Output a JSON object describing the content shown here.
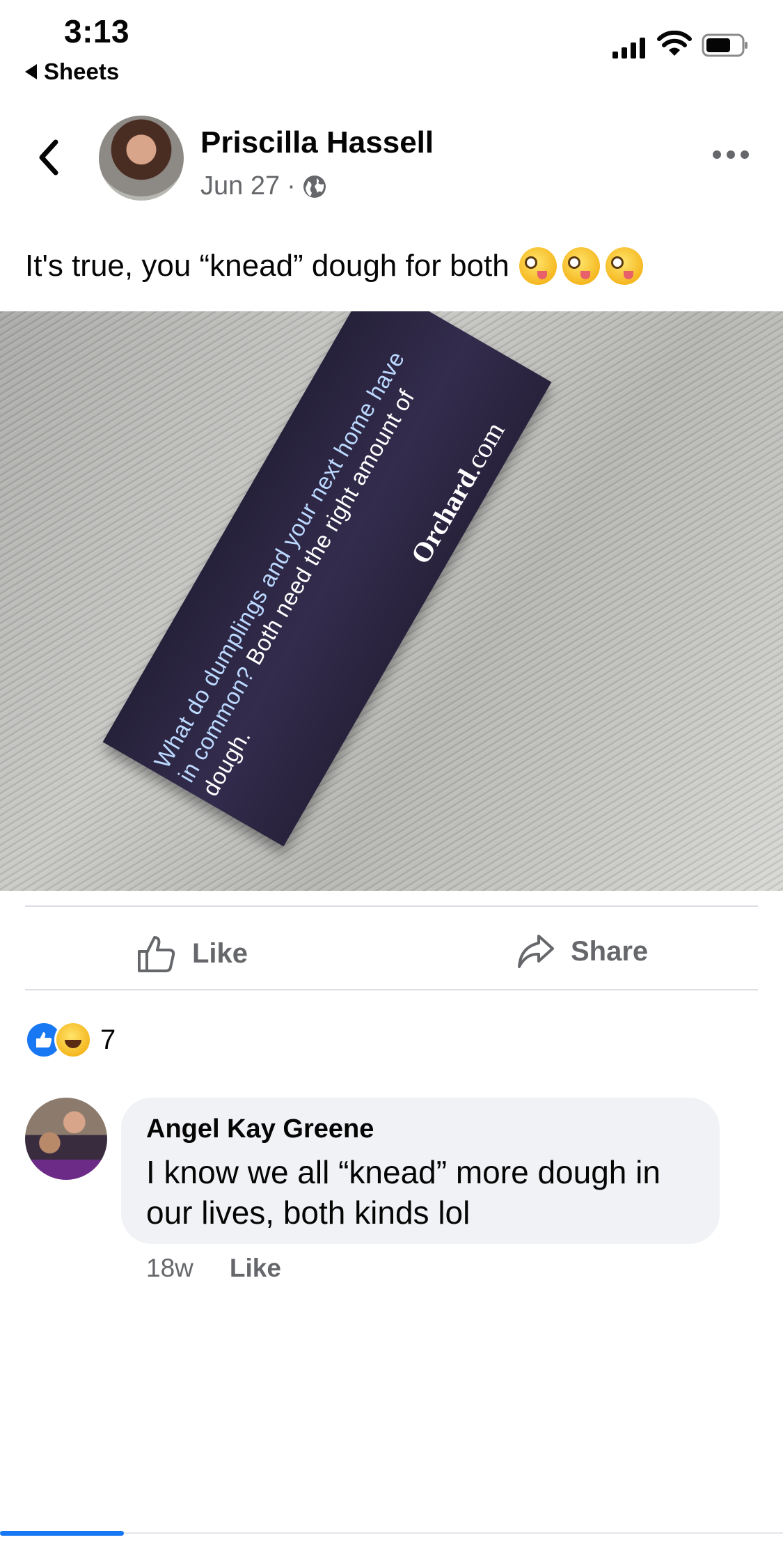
{
  "status_bar": {
    "time": "3:13",
    "back_app": "Sheets"
  },
  "post": {
    "author": "Priscilla Hassell",
    "date": "Jun 27",
    "separator": "·",
    "privacy_icon": "globe-icon",
    "caption": "It's true, you “knead” dough for both",
    "caption_emoji": "zany-face-emoji",
    "caption_emoji_count": 3,
    "photo": {
      "fortune_question": "What do dumplings and your next home have in common?",
      "fortune_answer": "Both need the right amount of dough.",
      "brand_bold": "Orchard",
      "brand_suffix": ".com"
    }
  },
  "actions": {
    "like_label": "Like",
    "share_label": "Share"
  },
  "reactions": {
    "types": [
      "like",
      "haha"
    ],
    "count": "7"
  },
  "comment": {
    "author": "Angel Kay Greene",
    "text": "I know we all “knead” more dough in our lives, both kinds lol",
    "age": "18w",
    "like_label": "Like"
  },
  "colors": {
    "accent": "#1877f2",
    "secondary_text": "#65676b",
    "bubble": "#f0f2f5"
  }
}
